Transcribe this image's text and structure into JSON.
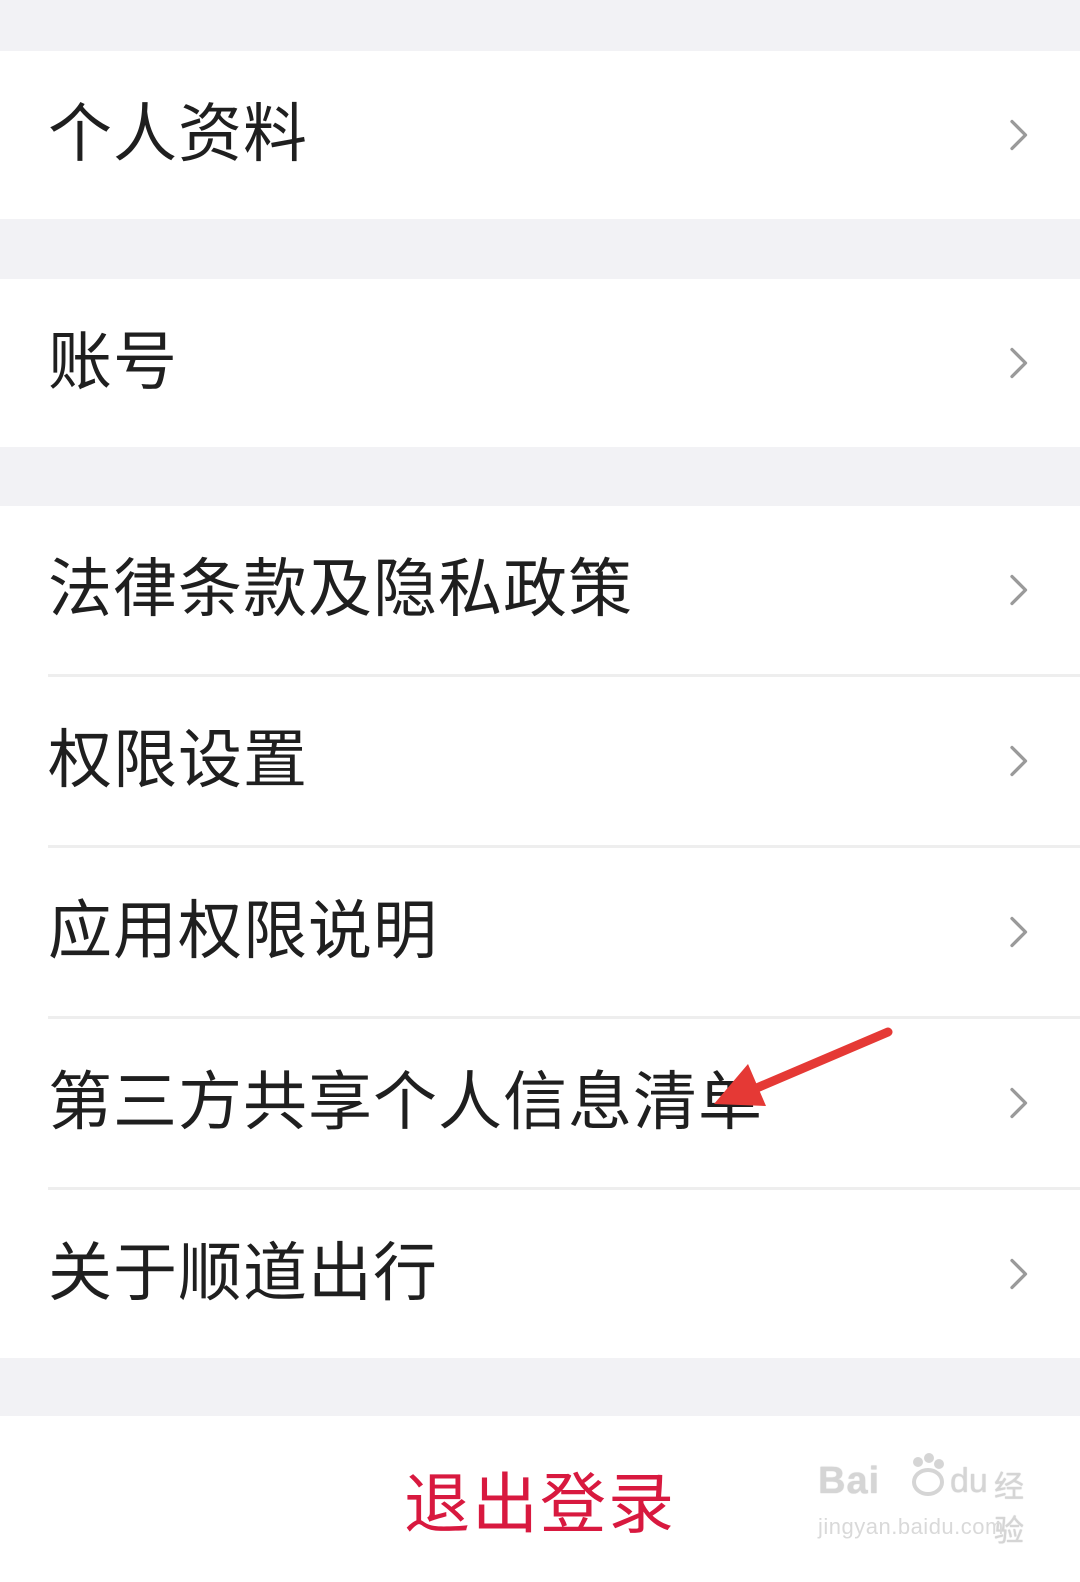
{
  "settings_groups": [
    {
      "items": [
        {
          "label": "个人资料"
        }
      ]
    },
    {
      "items": [
        {
          "label": "账号"
        }
      ]
    },
    {
      "items": [
        {
          "label": "法律条款及隐私政策"
        },
        {
          "label": "权限设置"
        },
        {
          "label": "应用权限说明"
        },
        {
          "label": "第三方共享个人信息清单"
        },
        {
          "label": "关于顺道出行"
        }
      ]
    }
  ],
  "logout": {
    "label": "退出登录"
  },
  "watermark": {
    "brand": "Bai",
    "brand_tail": "du",
    "text": "经验",
    "url": "jingyan.baidu.com"
  },
  "icons": {
    "row_chevron": "chevron-right-icon",
    "annotation": "red-arrow-icon"
  },
  "colors": {
    "page_background": "#f2f2f5",
    "card_background": "#ffffff",
    "text_primary": "#1f1f1f",
    "chevron": "#9a9a9a",
    "divider": "#eeeeee",
    "logout_text": "#d8193f",
    "annotation_arrow": "#e53935"
  }
}
